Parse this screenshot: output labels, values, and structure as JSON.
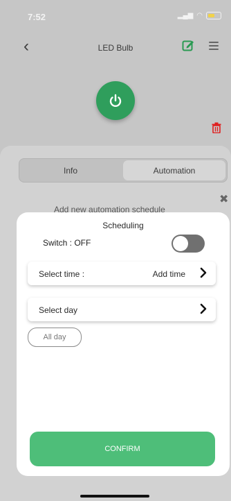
{
  "status": {
    "time": "7:52"
  },
  "header": {
    "title": "LED Bulb"
  },
  "tabs": [
    {
      "label": "Info"
    },
    {
      "label": "Automation"
    }
  ],
  "background_hint": "Add new automation schedule",
  "sheet": {
    "title": "Scheduling",
    "switch_label": "Switch : OFF",
    "switch_on": false,
    "select_time_label": "Select time :",
    "select_time_value": "Add time",
    "select_day_label": "Select day",
    "all_day_label": "All day",
    "confirm_label": "CONFIRM"
  },
  "colors": {
    "power_green": "#2f9e5c",
    "confirm_green": "#4ebe79",
    "trash_red": "#e02020",
    "edit_green": "#2a9a52"
  },
  "icons": [
    "back-icon",
    "edit-icon",
    "menu-icon",
    "power-icon",
    "trash-icon",
    "close-icon",
    "chevron-right-icon"
  ]
}
